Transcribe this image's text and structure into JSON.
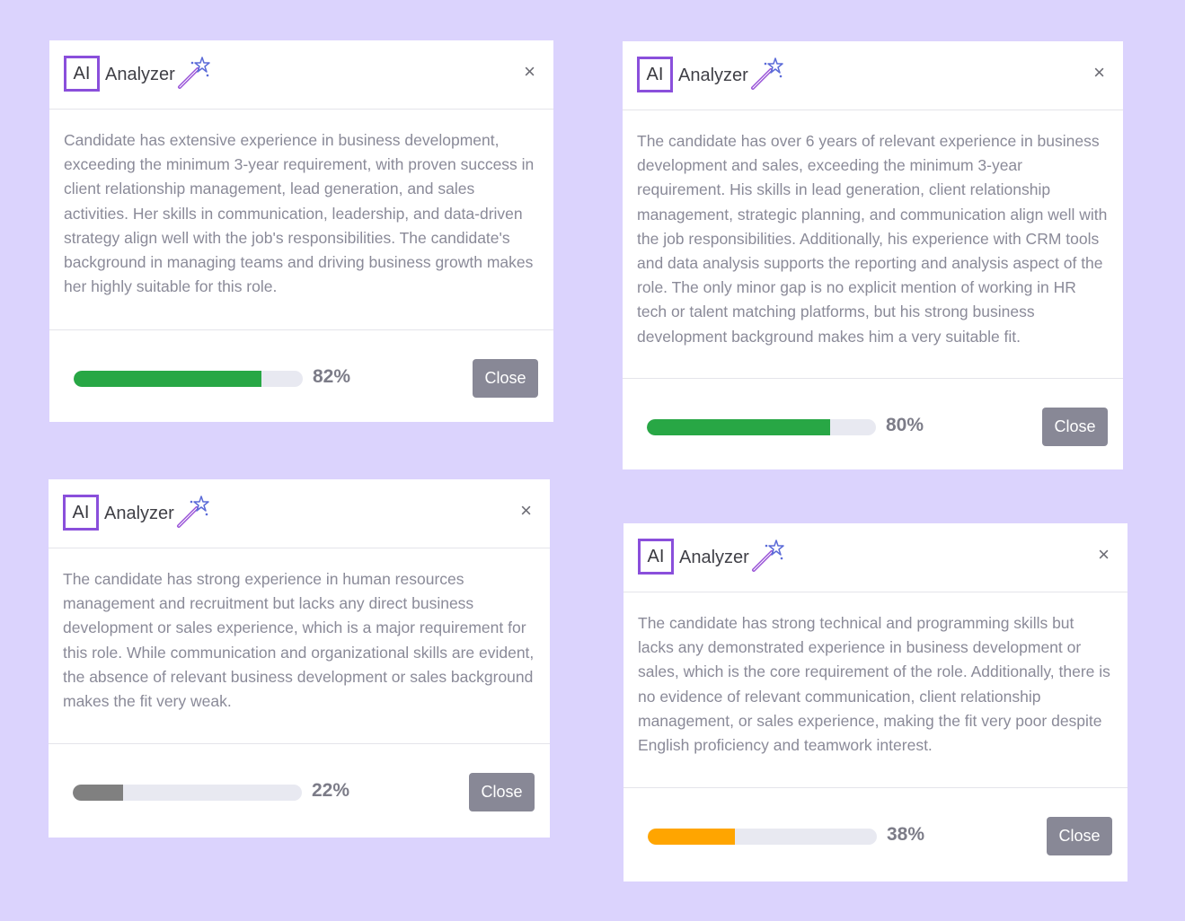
{
  "cards": [
    {
      "badge": "AI",
      "brand": "Analyzer",
      "close_icon": "×",
      "text": "Candidate has extensive experience in business development, exceeding the minimum 3-year requirement, with proven success in client relationship management, lead generation, and sales activities. Her skills in communication, leadership, and data-driven strategy align well with the job's responsibilities. The candidate's background in managing teams and driving business growth makes her highly suitable for this role.",
      "score": 82,
      "score_label": "82%",
      "bar_color": "#28a745",
      "close_label": "Close"
    },
    {
      "badge": "AI",
      "brand": "Analyzer",
      "close_icon": "×",
      "text": "The candidate has over 6 years of relevant experience in business development and sales, exceeding the minimum 3-year requirement. His skills in lead generation, client relationship management, strategic planning, and communication align well with the job responsibilities. Additionally, his experience with CRM tools and data analysis supports the reporting and analysis aspect of the role. The only minor gap is no explicit mention of working in HR tech or talent matching platforms, but his strong business development background makes him a very suitable fit.",
      "score": 80,
      "score_label": "80%",
      "bar_color": "#28a745",
      "close_label": "Close"
    },
    {
      "badge": "AI",
      "brand": "Analyzer",
      "close_icon": "×",
      "text": "The candidate has strong experience in human resources management and recruitment but lacks any direct business development or sales experience, which is a major requirement for this role. While communication and organizational skills are evident, the absence of relevant business development or sales background makes the fit very weak.",
      "score": 22,
      "score_label": "22%",
      "bar_color": "#808080",
      "close_label": "Close"
    },
    {
      "badge": "AI",
      "brand": "Analyzer",
      "close_icon": "×",
      "text": "The candidate has strong technical and programming skills but lacks any demonstrated experience in business development or sales, which is the core requirement of the role. Additionally, there is no evidence of relevant communication, client relationship management, or sales experience, making the fit very poor despite English proficiency and teamwork interest.",
      "score": 38,
      "score_label": "38%",
      "bar_color": "#ffa500",
      "close_label": "Close"
    }
  ]
}
